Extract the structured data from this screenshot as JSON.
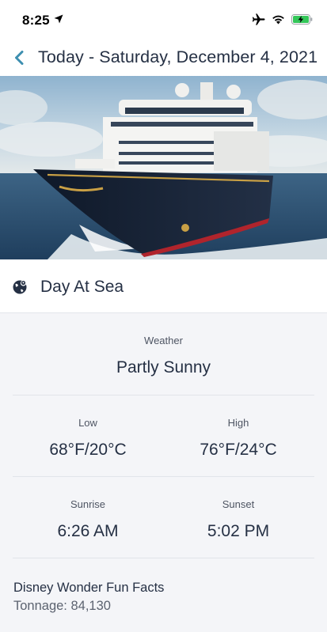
{
  "status_bar": {
    "time": "8:25",
    "icons": [
      "location-arrow-icon",
      "airplane-icon",
      "wifi-icon",
      "battery-charging-icon"
    ],
    "battery_color": "#34c759"
  },
  "nav": {
    "back_icon": "chevron-left-icon",
    "title": "Today - Saturday, December 4, 2021",
    "accent_color": "#3d8fb0"
  },
  "hero": {
    "description_icon": "cruise-ship-photo"
  },
  "port": {
    "icon": "globe-location-icon",
    "name": "Day At Sea"
  },
  "weather": {
    "label": "Weather",
    "value": "Partly Sunny"
  },
  "temps": {
    "low_label": "Low",
    "low_value": "68°F/20°C",
    "high_label": "High",
    "high_value": "76°F/24°C"
  },
  "sun": {
    "sunrise_label": "Sunrise",
    "sunrise_value": "6:26 AM",
    "sunset_label": "Sunset",
    "sunset_value": "5:02 PM"
  },
  "facts": {
    "title": "Disney Wonder Fun Facts",
    "tonnage": "Tonnage: 84,130"
  }
}
